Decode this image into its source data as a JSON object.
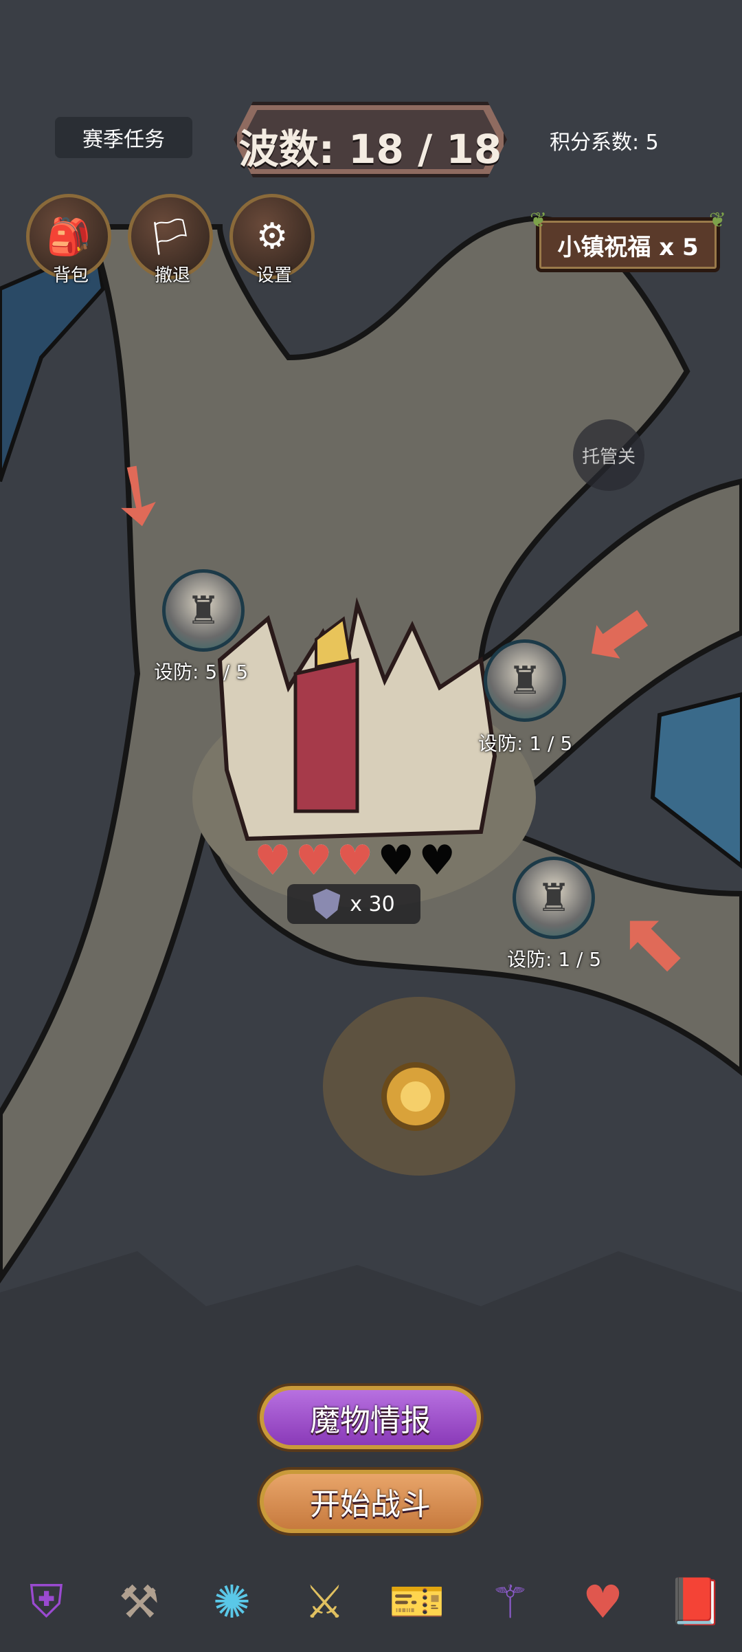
{
  "header": {
    "season_tasks": "赛季任务",
    "wave": "波数: 18 / 18",
    "score_coefficient": "积分系数: 5"
  },
  "menu": [
    {
      "label": "背包",
      "icon": "backpack-icon"
    },
    {
      "label": "撤退",
      "icon": "retreat-flag-icon"
    },
    {
      "label": "设置",
      "icon": "gear-icon"
    }
  ],
  "town_blessing": "小镇祝福 x 5",
  "auto_button": "托管关",
  "towers": [
    {
      "label": "设防: 5 / 5",
      "value": 5,
      "max": 5
    },
    {
      "label": "设防: 1 / 5",
      "value": 1,
      "max": 5
    },
    {
      "label": "设防: 1 / 5",
      "value": 1,
      "max": 5
    }
  ],
  "base": {
    "hearts_total": 5,
    "hearts_full": 3,
    "currency_label": "x 30"
  },
  "buttons": {
    "monster_info": "魔物情报",
    "start_battle": "开始战斗"
  },
  "bottom_bar": [
    {
      "icon": "shield-emblem-icon"
    },
    {
      "icon": "hammer-anvil-icon"
    },
    {
      "icon": "magic-orb-icon"
    },
    {
      "icon": "winged-axe-icon"
    },
    {
      "icon": "ticket-icon"
    },
    {
      "icon": "dark-halberd-icon"
    },
    {
      "icon": "heart-icon"
    },
    {
      "icon": "spellbook-icon"
    }
  ],
  "colors": {
    "arrow": "#e06a58",
    "heart_full": "#e0574e",
    "monster_button": "#a855d4",
    "start_button": "#d98f4e"
  }
}
